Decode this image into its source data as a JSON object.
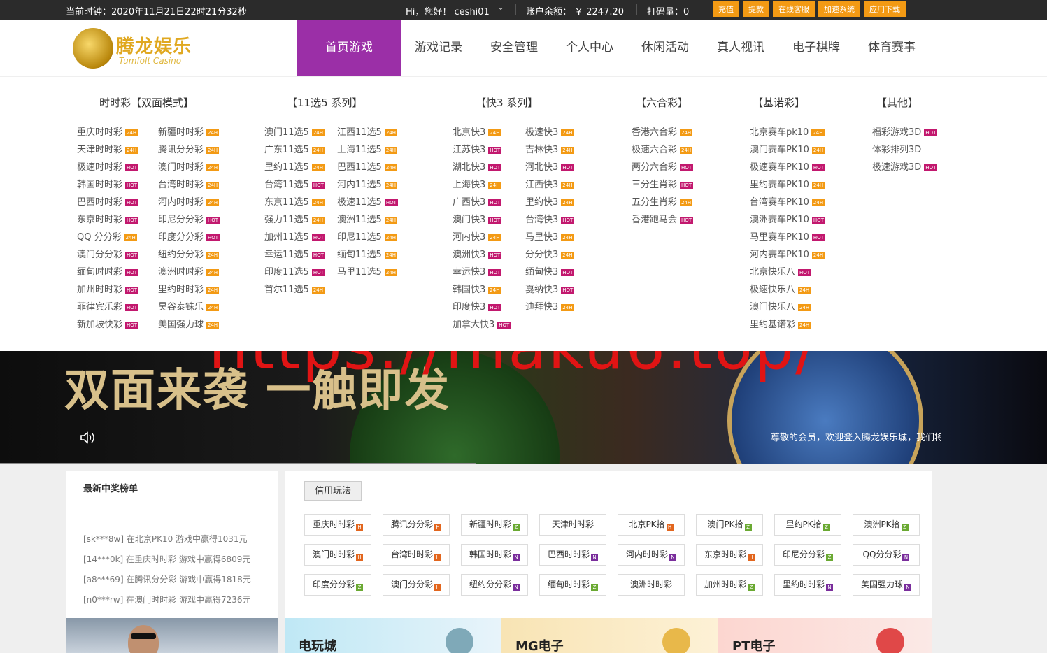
{
  "topbar": {
    "clock": "当前时钟：2020年11月21日22时21分32秒",
    "greeting": "Hi，您好！ ceshi01",
    "balance": "账户余额： ￥ 2247.20",
    "bet_volume": "打码量：0",
    "buttons": [
      "充值",
      "提款",
      "在线客服",
      "加速系统",
      "应用下载"
    ]
  },
  "logo": {
    "cn": "腾龙娱乐",
    "en": "Tumfolt Casino"
  },
  "nav": [
    "首页游戏",
    "游戏记录",
    "安全管理",
    "个人中心",
    "休闲活动",
    "真人视讯",
    "电子棋牌",
    "体育赛事"
  ],
  "menu": [
    {
      "title": "时时彩【双面模式】",
      "cols": 2,
      "items": [
        {
          "name": "重庆时时彩",
          "tag": "24H"
        },
        {
          "name": "新疆时时彩",
          "tag": "24H"
        },
        {
          "name": "天津时时彩",
          "tag": "24H"
        },
        {
          "name": "腾讯分分彩",
          "tag": "24H"
        },
        {
          "name": "极速时时彩",
          "tag": "HOT"
        },
        {
          "name": "澳门时时彩",
          "tag": "24H"
        },
        {
          "name": "韩国时时彩",
          "tag": "HOT"
        },
        {
          "name": "台湾时时彩",
          "tag": "24H"
        },
        {
          "name": "巴西时时彩",
          "tag": "HOT"
        },
        {
          "name": "河内时时彩",
          "tag": "24H"
        },
        {
          "name": "东京时时彩",
          "tag": "HOT"
        },
        {
          "name": "印尼分分彩",
          "tag": "HOT"
        },
        {
          "name": "QQ 分分彩",
          "tag": "24H"
        },
        {
          "name": "印度分分彩",
          "tag": "HOT"
        },
        {
          "name": "澳门分分彩",
          "tag": "HOT"
        },
        {
          "name": "纽约分分彩",
          "tag": "24H"
        },
        {
          "name": "缅甸时时彩",
          "tag": "HOT"
        },
        {
          "name": "澳洲时时彩",
          "tag": "24H"
        },
        {
          "name": "加州时时彩",
          "tag": "HOT"
        },
        {
          "name": "里约时时彩",
          "tag": "24H"
        },
        {
          "name": "菲律宾乐彩",
          "tag": "HOT"
        },
        {
          "name": "昊谷泰铢乐",
          "tag": "24H"
        },
        {
          "name": "新加坡快彩",
          "tag": "HOT"
        },
        {
          "name": "美国强力球",
          "tag": "24H"
        }
      ]
    },
    {
      "title": "【11选5 系列】",
      "cols": 2,
      "items": [
        {
          "name": "澳门11选5",
          "tag": "24H"
        },
        {
          "name": "江西11选5",
          "tag": "24H"
        },
        {
          "name": "广东11选5",
          "tag": "24H"
        },
        {
          "name": "上海11选5",
          "tag": "24H"
        },
        {
          "name": "里约11选5",
          "tag": "24H"
        },
        {
          "name": "巴西11选5",
          "tag": "24H"
        },
        {
          "name": "台湾11选5",
          "tag": "HOT"
        },
        {
          "name": "河内11选5",
          "tag": "24H"
        },
        {
          "name": "东京11选5",
          "tag": "24H"
        },
        {
          "name": "极速11选5",
          "tag": "HOT"
        },
        {
          "name": "强力11选5",
          "tag": "24H"
        },
        {
          "name": "澳洲11选5",
          "tag": "24H"
        },
        {
          "name": "加州11选5",
          "tag": "HOT"
        },
        {
          "name": "印尼11选5",
          "tag": "24H"
        },
        {
          "name": "幸运11选5",
          "tag": "HOT"
        },
        {
          "name": "缅甸11选5",
          "tag": "24H"
        },
        {
          "name": "印度11选5",
          "tag": "HOT"
        },
        {
          "name": "马里11选5",
          "tag": "24H"
        },
        {
          "name": "首尔11选5",
          "tag": "24H"
        }
      ]
    },
    {
      "title": "【快3 系列】",
      "cols": 2,
      "items": [
        {
          "name": "北京快3",
          "tag": "24H"
        },
        {
          "name": "极速快3",
          "tag": "24H"
        },
        {
          "name": "江苏快3",
          "tag": "HOT"
        },
        {
          "name": "吉林快3",
          "tag": "24H"
        },
        {
          "name": "湖北快3",
          "tag": "HOT"
        },
        {
          "name": "河北快3",
          "tag": "HOT"
        },
        {
          "name": "上海快3",
          "tag": "24H"
        },
        {
          "name": "江西快3",
          "tag": "24H"
        },
        {
          "name": "广西快3",
          "tag": "HOT"
        },
        {
          "name": "里约快3",
          "tag": "24H"
        },
        {
          "name": "澳门快3",
          "tag": "HOT"
        },
        {
          "name": "台湾快3",
          "tag": "HOT"
        },
        {
          "name": "河内快3",
          "tag": "24H"
        },
        {
          "name": "马里快3",
          "tag": "24H"
        },
        {
          "name": "澳洲快3",
          "tag": "HOT"
        },
        {
          "name": "分分快3",
          "tag": "24H"
        },
        {
          "name": "幸运快3",
          "tag": "HOT"
        },
        {
          "name": "缅甸快3",
          "tag": "HOT"
        },
        {
          "name": "韩国快3",
          "tag": "24H"
        },
        {
          "name": "戛纳快3",
          "tag": "HOT"
        },
        {
          "name": "印度快3",
          "tag": "HOT"
        },
        {
          "name": "迪拜快3",
          "tag": "24H"
        },
        {
          "name": "加拿大快3",
          "tag": "HOT"
        }
      ]
    },
    {
      "title": "【六合彩】",
      "cols": 1,
      "items": [
        {
          "name": "香港六合彩",
          "tag": "24H"
        },
        {
          "name": "极速六合彩",
          "tag": "24H"
        },
        {
          "name": "两分六合彩",
          "tag": "HOT"
        },
        {
          "name": "三分生肖彩",
          "tag": "HOT"
        },
        {
          "name": "五分生肖彩",
          "tag": "24H"
        },
        {
          "name": "香港跑马会",
          "tag": "HOT"
        }
      ]
    },
    {
      "title": "【基诺彩】",
      "cols": 1,
      "items": [
        {
          "name": "北京赛车pk10",
          "tag": "24H"
        },
        {
          "name": "澳门赛车PK10",
          "tag": "24H"
        },
        {
          "name": "极速赛车PK10",
          "tag": "HOT"
        },
        {
          "name": "里约赛车PK10",
          "tag": "24H"
        },
        {
          "name": "台湾赛车PK10",
          "tag": "24H"
        },
        {
          "name": "澳洲赛车PK10",
          "tag": "HOT"
        },
        {
          "name": "马里赛车PK10",
          "tag": "HOT"
        },
        {
          "name": "河内赛车PK10",
          "tag": "24H"
        },
        {
          "name": "北京快乐八",
          "tag": "HOT"
        },
        {
          "name": "极速快乐八",
          "tag": "24H"
        },
        {
          "name": "澳门快乐八",
          "tag": "24H"
        },
        {
          "name": "里约基诺彩",
          "tag": "24H"
        }
      ]
    },
    {
      "title": "【其他】",
      "cols": 1,
      "items": [
        {
          "name": "福彩游戏3D",
          "tag": "HOT"
        },
        {
          "name": "体彩排列3D",
          "tag": ""
        },
        {
          "name": "极速游戏3D",
          "tag": "HOT"
        }
      ]
    }
  ],
  "banner": {
    "headline": "双面来袭 一触即发",
    "watermark": "https://maku6.top/",
    "notice": "尊敬的会员，欢迎登入腾龙娱乐城，我们将"
  },
  "winners": {
    "title": "最新中奖榜单",
    "items": [
      "[sk***8w] 在北京PK10 游戏中赢得1031元",
      "[14***0k] 在重庆时时彩 游戏中赢得6809元",
      "[a8***69] 在腾讯分分彩 游戏中赢得1818元",
      "[n0***rw] 在澳门时时彩 游戏中赢得7236元"
    ]
  },
  "credit": {
    "tab": "信用玩法",
    "cards": [
      {
        "name": "重庆时时彩",
        "tag": "H"
      },
      {
        "name": "腾讯分分彩",
        "tag": "H"
      },
      {
        "name": "新疆时时彩",
        "tag": "Z"
      },
      {
        "name": "天津时时彩",
        "tag": ""
      },
      {
        "name": "北京PK拾",
        "tag": "H"
      },
      {
        "name": "澳门PK拾",
        "tag": "Z"
      },
      {
        "name": "里约PK拾",
        "tag": "Z"
      },
      {
        "name": "澳洲PK拾",
        "tag": "Z"
      },
      {
        "name": "澳门时时彩",
        "tag": "H"
      },
      {
        "name": "台湾时时彩",
        "tag": "H"
      },
      {
        "name": "韩国时时彩",
        "tag": "N"
      },
      {
        "name": "巴西时时彩",
        "tag": "N"
      },
      {
        "name": "河内时时彩",
        "tag": "N"
      },
      {
        "name": "东京时时彩",
        "tag": "H"
      },
      {
        "name": "印尼分分彩",
        "tag": "Z"
      },
      {
        "name": "QQ分分彩",
        "tag": "N"
      },
      {
        "name": "印度分分彩",
        "tag": "Z"
      },
      {
        "name": "澳门分分彩",
        "tag": "H"
      },
      {
        "name": "纽约分分彩",
        "tag": "N"
      },
      {
        "name": "缅甸时时彩",
        "tag": "Z"
      },
      {
        "name": "澳洲时时彩",
        "tag": ""
      },
      {
        "name": "加州时时彩",
        "tag": "Z"
      },
      {
        "name": "里约时时彩",
        "tag": "N"
      },
      {
        "name": "美国强力球",
        "tag": "N"
      }
    ]
  },
  "promos": [
    "电玩城",
    "MG电子",
    "PT电子"
  ]
}
